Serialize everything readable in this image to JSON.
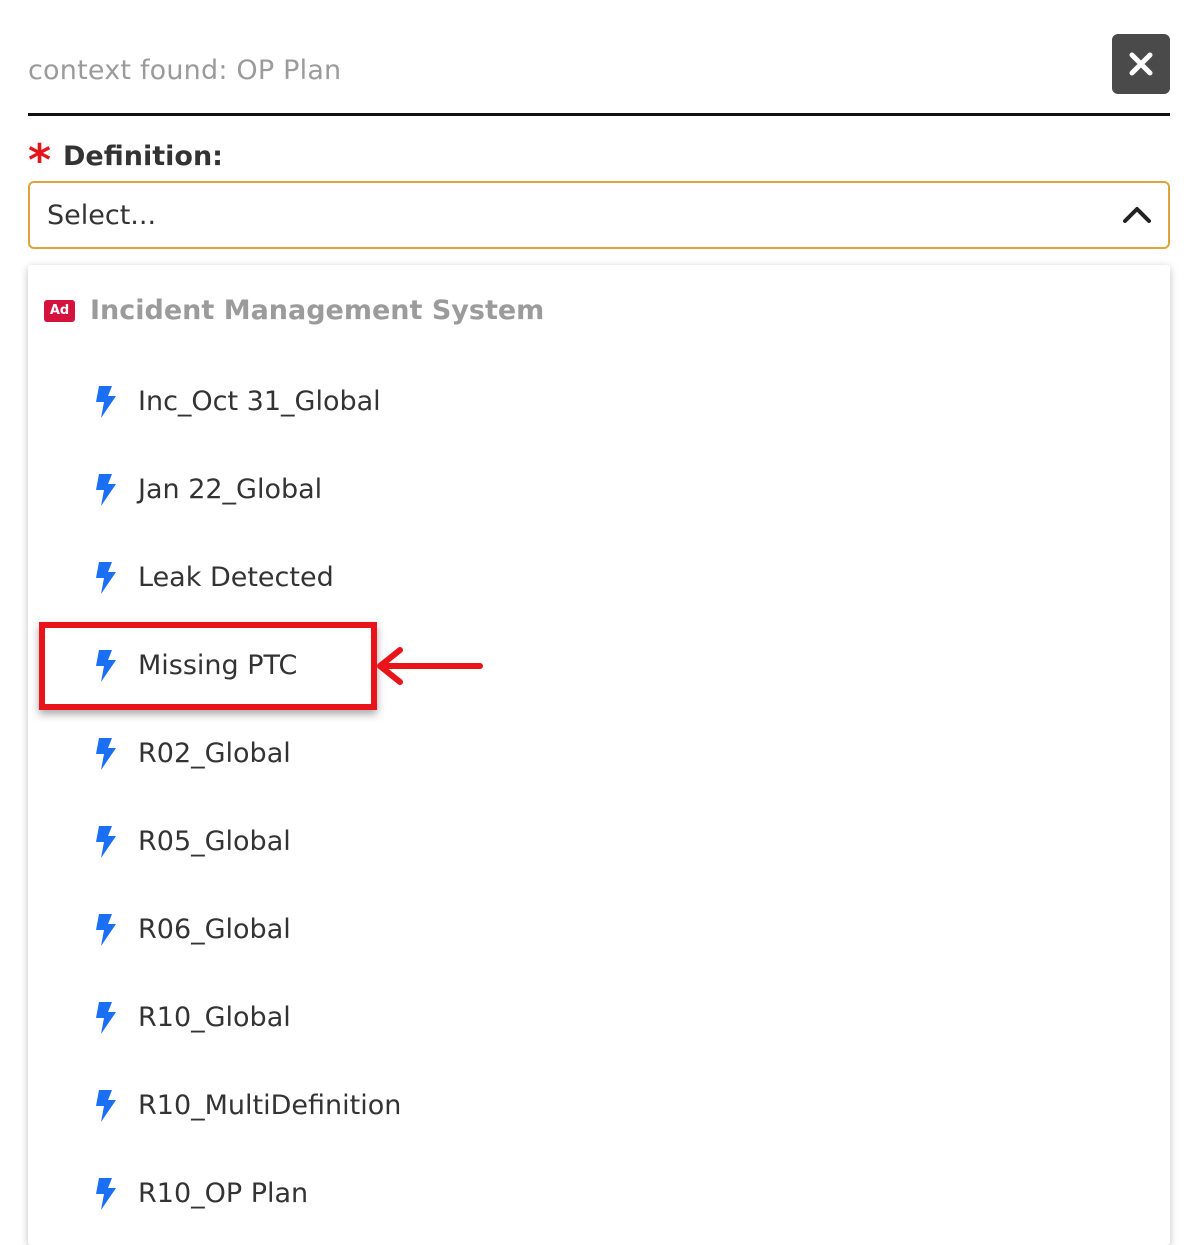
{
  "context": {
    "text": "context found: OP Plan"
  },
  "close_button": {
    "icon": "close-icon"
  },
  "field": {
    "required_mark": "*",
    "label": "Definition:"
  },
  "select": {
    "placeholder": "Select..."
  },
  "dropdown": {
    "group": {
      "badge": "Ad",
      "title": "Incident Management System"
    },
    "options": [
      {
        "label": "Inc_Oct 31_Global",
        "icon": "bolt-icon"
      },
      {
        "label": "Jan 22_Global",
        "icon": "bolt-icon"
      },
      {
        "label": "Leak Detected",
        "icon": "bolt-icon"
      },
      {
        "label": "Missing PTC",
        "icon": "bolt-icon",
        "highlighted": true
      },
      {
        "label": "R02_Global",
        "icon": "bolt-icon"
      },
      {
        "label": "R05_Global",
        "icon": "bolt-icon"
      },
      {
        "label": "R06_Global",
        "icon": "bolt-icon"
      },
      {
        "label": "R10_Global",
        "icon": "bolt-icon"
      },
      {
        "label": "R10_MultiDefinition",
        "icon": "bolt-icon"
      },
      {
        "label": "R10_OP Plan",
        "icon": "bolt-icon"
      }
    ]
  },
  "colors": {
    "accent_border": "#e0a33a",
    "required": "#e5161b",
    "bolt": "#1a6ff5",
    "highlight": "#e8141a",
    "badge": "#d4123c"
  }
}
